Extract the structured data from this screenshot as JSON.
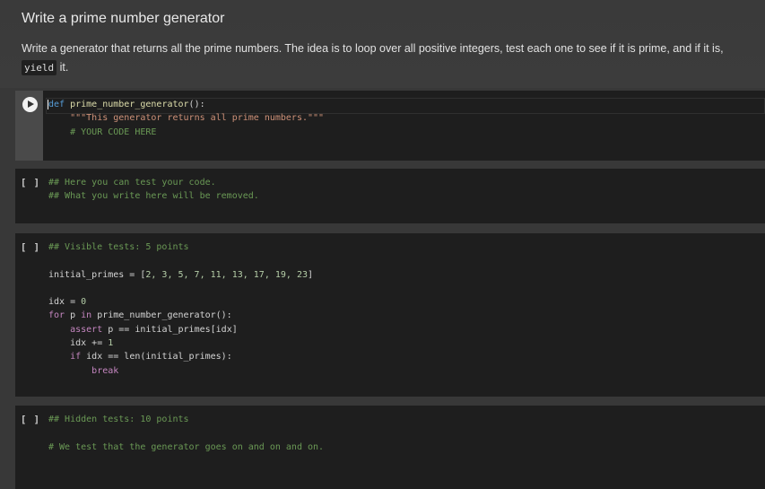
{
  "markdown": {
    "title": "Write a prime number generator",
    "text_before": "Write a generator that returns all the prime numbers. The idea is to loop over all positive integers, test each one to see if it is prime, and if it is,",
    "code_word": "yield",
    "text_after": " it."
  },
  "cells": [
    {
      "id": "cell-1",
      "bracket": "",
      "run_icon": "play-icon",
      "lines": {
        "l1_kw": "def",
        "l1_fn": "prime_number_generator",
        "l1_rest": "():",
        "l2": "\"\"\"This generator returns all prime numbers.\"\"\"",
        "l3": "# YOUR CODE HERE"
      }
    },
    {
      "id": "cell-2",
      "bracket": "[ ]",
      "lines": {
        "l1": "## Here you can test your code.",
        "l2": "## What you write here will be removed."
      }
    },
    {
      "id": "cell-3",
      "bracket": "[ ]",
      "lines": {
        "l1": "## Visible tests: 5 points",
        "l2_a": "initial_primes = [",
        "l2_nums": "2, 3, 5, 7, 11, 13, 17, 19, 23",
        "l2_b": "]",
        "l3_a": "idx = ",
        "l3_num": "0",
        "l4_kw": "for",
        "l4_a": " p ",
        "l4_kw2": "in",
        "l4_b": " prime_number_generator():",
        "l5_kw": "assert",
        "l5_a": " p == initial_primes[idx]",
        "l6_a": "idx += ",
        "l6_num": "1",
        "l7_kw": "if",
        "l7_a": " idx == len(initial_primes):",
        "l8_kw": "break"
      }
    },
    {
      "id": "cell-4",
      "bracket": "[ ]",
      "lines": {
        "l1": "## Hidden tests: 10 points",
        "l2": "# We test that the generator goes on and on and on."
      }
    }
  ]
}
